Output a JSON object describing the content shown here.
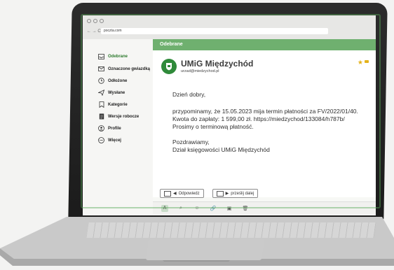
{
  "browser": {
    "url": "poczta.com",
    "nav_back": "←",
    "nav_forward": "→",
    "nav_reload": "C"
  },
  "sidebar": {
    "items": [
      {
        "label": "Odebrane",
        "icon": "inbox-icon",
        "active": true
      },
      {
        "label": "Oznaczone gwiazdką",
        "icon": "mail-icon"
      },
      {
        "label": "Odłożone",
        "icon": "clock-icon"
      },
      {
        "label": "Wysłane",
        "icon": "send-icon"
      },
      {
        "label": "Kategorie",
        "icon": "bookmark-icon"
      },
      {
        "label": "Wersje robocze",
        "icon": "draft-icon"
      },
      {
        "label": "Profile",
        "icon": "person-icon"
      },
      {
        "label": "Więcej",
        "icon": "more-icon"
      }
    ]
  },
  "folder": {
    "title": "Odebrane"
  },
  "message": {
    "sender_name": "UMiG Międzychód",
    "sender_email": "urzad@miedzychod.pl",
    "greeting": "Dzień dobry,",
    "line1": "przypominamy, że 15.05.2023 mija termin płatności za FV/2022/01/40.",
    "line2": "Kwota do zapłaty:  1 599,00 zł. https://miedzychod/133084/h787b/",
    "line3": "Prosimy o terminową płatność.",
    "closing": "Pozdrawiamy,",
    "signature": "Dział księgowości UMiG Międzychód"
  },
  "actions": {
    "reply": "Odpowiedz",
    "forward": "prześlij dalej"
  },
  "toolbar": {
    "format": "A",
    "attach": "⌕",
    "emoji": "☺",
    "link": "🔗",
    "image": "▣",
    "delete": "🗑"
  },
  "colors": {
    "accent": "#6fb06f",
    "logo": "#2f8a3a",
    "star": "#e4b21b"
  }
}
